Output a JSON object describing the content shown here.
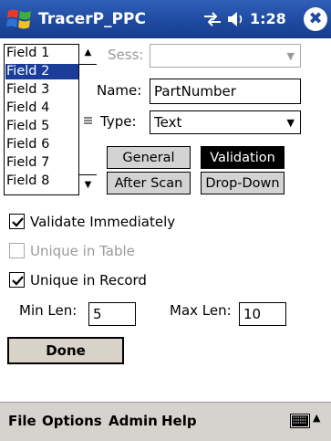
{
  "title_bar": {
    "app_title": "TracerP_PPC",
    "clock": "1:28",
    "close_label": "✖"
  },
  "field_list": {
    "items": [
      "Field 1",
      "Field 2",
      "Field 3",
      "Field 4",
      "Field 5",
      "Field 6",
      "Field 7",
      "Field 8"
    ],
    "selected": "Field 2"
  },
  "form": {
    "sess_label": "Sess:",
    "sess_value": "",
    "name_label": "Name:",
    "name_value": "PartNumber",
    "type_label": "Type:",
    "type_value": "Text"
  },
  "tabs": {
    "general": "General",
    "validation": "Validation",
    "after_scan": "After Scan",
    "drop_down": "Drop-Down",
    "active": "Validation"
  },
  "options": {
    "validate_immediately": {
      "label": "Validate Immediately",
      "checked": true,
      "enabled": true
    },
    "unique_in_table": {
      "label": "Unique in Table",
      "checked": false,
      "enabled": false
    },
    "unique_in_record": {
      "label": "Unique in Record",
      "checked": true,
      "enabled": true
    }
  },
  "lengths": {
    "min_label": "Min Len:",
    "min_value": "5",
    "max_label": "Max Len:",
    "max_value": "10"
  },
  "done_label": "Done",
  "menu_bar": {
    "file": "File",
    "options": "Options",
    "admin": "Admin",
    "help": "Help"
  },
  "icons": {
    "start": "windows-flag-icon",
    "connectivity": "connectivity-icon",
    "volume": "speaker-icon",
    "keyboard": "keyboard-icon"
  },
  "colors": {
    "title_bar": "#1f4aa0",
    "selection": "#1a3d9a",
    "active_tab": "#000000",
    "menu_bar": "#d6d3ce"
  }
}
